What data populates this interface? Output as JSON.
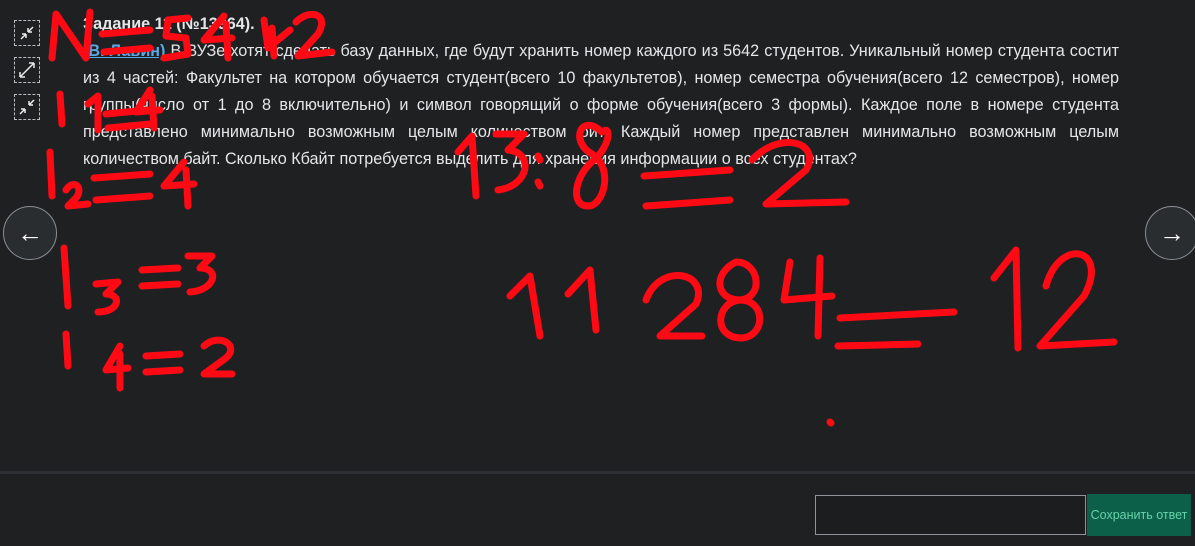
{
  "toolbar": {
    "buttons": [
      {
        "icon": "shrink-icon"
      },
      {
        "icon": "expand-icon"
      },
      {
        "icon": "collapse-icon"
      }
    ]
  },
  "task": {
    "title": "Задание 11 (№13964).",
    "author": "(В. Лавин)",
    "text": " В ВУЗе хотят сделать базу данных, где будут хранить номер каждого из 5642 студентов. Уникальный номер студента состит из 4 частей: Факультет на котором обучается студент(всего 10 факультетов), номер семестра обучения(всего 12 семестров), номер группы(число от 1 до 8 включительно) и символ говорящий о форме обучения(всего 3 формы). Каждое поле в номере студента представлено минимально возможным целым количеством бит. Каждый номер представлен минимально возможным целым количеством байт. Сколько Кбайт потребуется выделить для хранения информации о всех студентах?"
  },
  "navigation": {
    "prev_label": "←",
    "next_label": "→"
  },
  "answer": {
    "value": "",
    "placeholder": "",
    "save_label": "Сохранить ответ"
  },
  "annotation": {
    "color": "#ff0a14",
    "lines": [
      "N = 5642",
      "i1 = 4",
      "i2 = 4",
      "i3 = 3",
      "i4 = 2",
      "13 : 8 = 2",
      "11 284 = 12"
    ]
  }
}
